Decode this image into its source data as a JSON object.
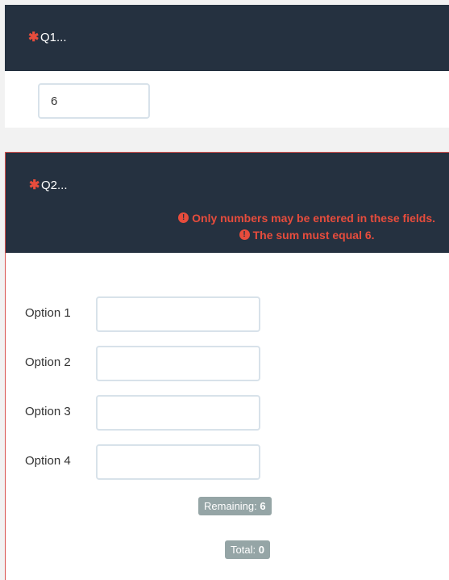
{
  "q1": {
    "title": "Q1...",
    "answer_value": "6"
  },
  "q2": {
    "title": "Q2...",
    "errors": [
      "Only numbers may be entered in these fields.",
      "The sum must equal 6."
    ],
    "options": [
      {
        "label": "Option 1",
        "value": ""
      },
      {
        "label": "Option 2",
        "value": ""
      },
      {
        "label": "Option 3",
        "value": ""
      },
      {
        "label": "Option 4",
        "value": ""
      }
    ],
    "remaining_label": "Remaining:",
    "remaining_value": "6",
    "total_label": "Total:",
    "total_value": "0"
  },
  "colors": {
    "header_bg": "#253140",
    "error": "#e74c3c",
    "pill_bg": "#95a5a6"
  },
  "icons": {
    "required": "asterisk-icon",
    "error": "exclamation-circle-icon"
  }
}
